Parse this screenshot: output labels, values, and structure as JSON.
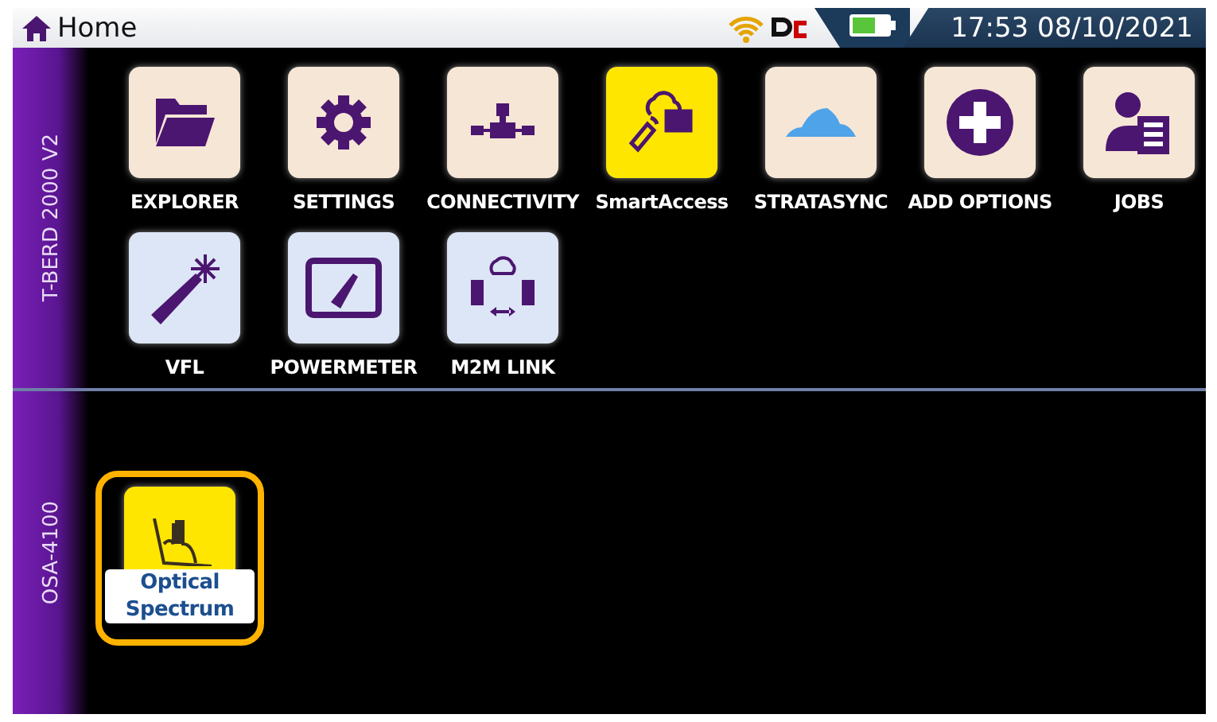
{
  "status_bar": {
    "title": "Home",
    "clock": "17:53 08/10/2021"
  },
  "sections": [
    {
      "label": "T-BERD 2000 V2",
      "tiles": [
        {
          "kind": "folder",
          "label": "EXPLORER",
          "color": "#f6e6d6",
          "selected": false,
          "boxed_label": false
        },
        {
          "kind": "gear",
          "label": "SETTINGS",
          "color": "#f6e6d6",
          "selected": false,
          "boxed_label": false
        },
        {
          "kind": "network",
          "label": "CONNECTIVITY",
          "color": "#f6e6d6",
          "selected": false,
          "boxed_label": false
        },
        {
          "kind": "remote",
          "label": "SmartAccess",
          "color": "#ffe600",
          "selected": false,
          "boxed_label": false
        },
        {
          "kind": "cloud",
          "label": "STRATASYNC",
          "color": "#f6e6d6",
          "selected": false,
          "boxed_label": false
        },
        {
          "kind": "plus",
          "label": "ADD OPTIONS",
          "color": "#f6e6d6",
          "selected": false,
          "boxed_label": false
        },
        {
          "kind": "person",
          "label": "JOBS",
          "color": "#f6e6d6",
          "selected": false,
          "boxed_label": false
        },
        {
          "kind": "laser",
          "label": "VFL",
          "color": "#dde6f6",
          "selected": false,
          "boxed_label": false
        },
        {
          "kind": "meter",
          "label": "POWERMETER",
          "color": "#dde6f6",
          "selected": false,
          "boxed_label": false
        },
        {
          "kind": "link",
          "label": "M2M LINK",
          "color": "#dde6f6",
          "selected": false,
          "boxed_label": false
        }
      ]
    },
    {
      "label": "OSA-4100",
      "tiles": [
        {
          "kind": "spectrum",
          "label": "Optical\nSpectrum",
          "color": "#ffe600",
          "selected": true,
          "boxed_label": true
        }
      ]
    }
  ]
}
